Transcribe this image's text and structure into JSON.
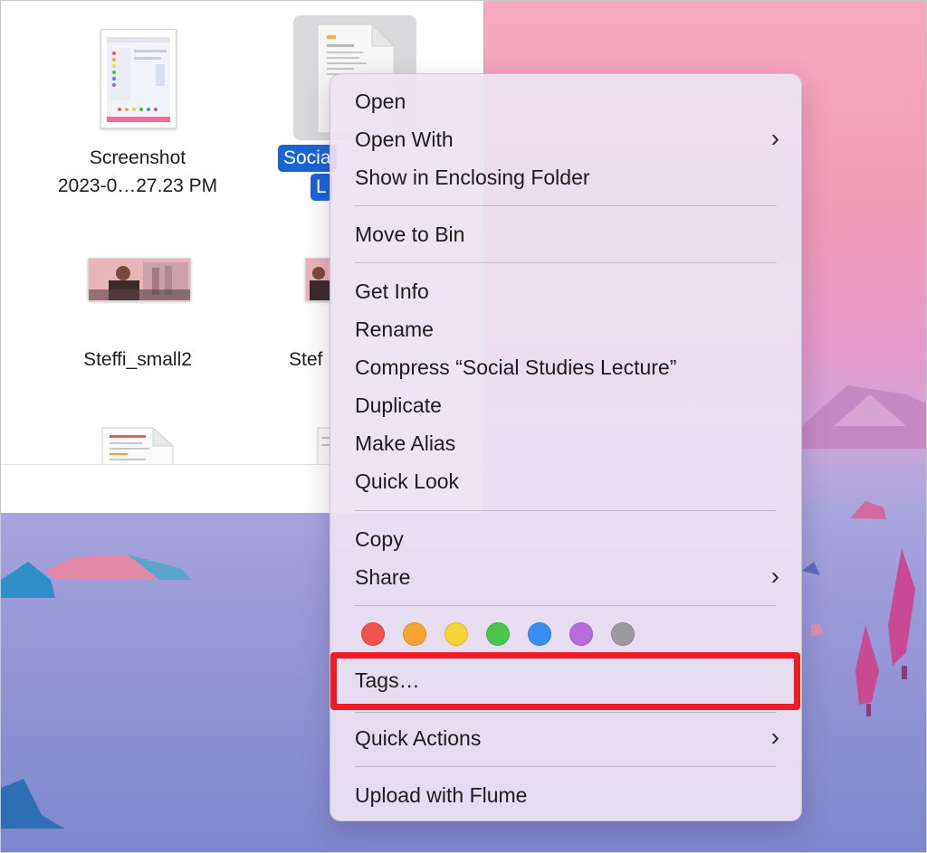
{
  "finder": {
    "files": [
      {
        "label_line1": "Screenshot",
        "label_line2": "2023-0…27.23 PM"
      },
      {
        "label_line1": "Socia",
        "label_line2": "L",
        "selected": true
      },
      {
        "label_line1": "Steffi_small2"
      },
      {
        "label_line1": "Stef"
      }
    ]
  },
  "context_menu": {
    "groups": [
      [
        {
          "label": "Open"
        },
        {
          "label": "Open With",
          "submenu": true
        },
        {
          "label": "Show in Enclosing Folder"
        }
      ],
      [
        {
          "label": "Move to Bin"
        }
      ],
      [
        {
          "label": "Get Info"
        },
        {
          "label": "Rename"
        },
        {
          "label": "Compress “Social Studies Lecture”"
        },
        {
          "label": "Duplicate"
        },
        {
          "label": "Make Alias"
        },
        {
          "label": "Quick Look"
        }
      ],
      [
        {
          "label": "Copy"
        },
        {
          "label": "Share",
          "submenu": true
        }
      ],
      [
        {
          "label": "Tags…"
        }
      ],
      [
        {
          "label": "Quick Actions",
          "submenu": true
        }
      ],
      [
        {
          "label": "Upload with Flume"
        }
      ]
    ],
    "tag_colors": [
      {
        "name": "red",
        "color": "#f0524f"
      },
      {
        "name": "orange",
        "color": "#f6a332"
      },
      {
        "name": "yellow",
        "color": "#f8d33a"
      },
      {
        "name": "green",
        "color": "#4cc54f"
      },
      {
        "name": "blue",
        "color": "#3a8ef2"
      },
      {
        "name": "purple",
        "color": "#b56bd9"
      },
      {
        "name": "gray",
        "color": "#9b9b9e"
      }
    ],
    "chevron": "›",
    "highlight_color": "#ee1c25"
  }
}
